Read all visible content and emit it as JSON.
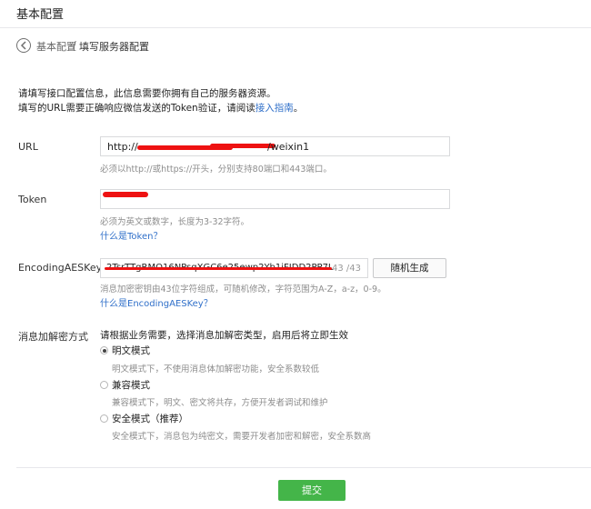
{
  "header": {
    "title": "基本配置"
  },
  "breadcrumb": {
    "parent": "基本配置",
    "separator": "/",
    "current": "填写服务器配置"
  },
  "notice": {
    "line1": "请填写接口配置信息，此信息需要你拥有自己的服务器资源。",
    "line2_prefix": "填写的URL需要正确响应微信发送的Token验证，请阅读",
    "line2_link": "接入指南",
    "line2_suffix": "。"
  },
  "form": {
    "url": {
      "label": "URL",
      "value_prefix": "http://",
      "value_suffix": "/weixin1",
      "hint": "必须以http://或https://开头，分别支持80端口和443端口。"
    },
    "token": {
      "label": "Token",
      "hint": "必须为英文或数字，长度为3-32字符。",
      "help_link": "什么是Token？"
    },
    "aes": {
      "label": "EncodingAESKey",
      "value": "2TsrTTgRMO16NPsqXGC6e25ewp2Yb1iFIDD2PP7Lxtf",
      "counter": "43 /43",
      "random_button": "随机生成",
      "hint": "消息加密密钥由43位字符组成，可随机修改，字符范围为A-Z，a-z，0-9。",
      "help_link": "什么是EncodingAESKey？"
    },
    "encryption": {
      "label": "消息加解密方式",
      "intro": "请根据业务需要，选择消息加解密类型，启用后将立即生效",
      "modes": [
        {
          "label": "明文模式",
          "desc": "明文模式下，不使用消息体加解密功能，安全系数较低",
          "checked": true
        },
        {
          "label": "兼容模式",
          "desc": "兼容模式下，明文、密文将共存，方便开发者调试和维护",
          "checked": false
        },
        {
          "label": "安全模式（推荐）",
          "desc": "安全模式下，消息包为纯密文，需要开发者加密和解密，安全系数高",
          "checked": false
        }
      ]
    },
    "submit": "提交"
  },
  "colors": {
    "accent_green": "#44b549",
    "link_blue": "#2f6fc9",
    "redaction_red": "#ee1212"
  },
  "icons": {
    "back": "back-arrow-circle-icon"
  }
}
